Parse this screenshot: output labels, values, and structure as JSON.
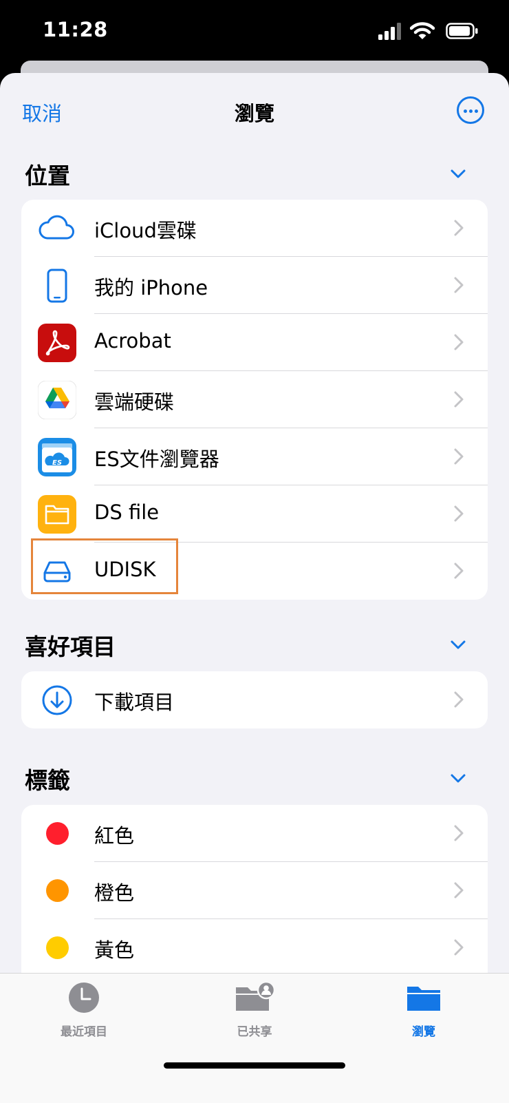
{
  "status_bar": {
    "time": "11:28"
  },
  "nav": {
    "cancel": "取消",
    "title": "瀏覽"
  },
  "sections": {
    "locations": {
      "title": "位置",
      "items": [
        {
          "label": "iCloud雲碟",
          "icon": "cloud-icon"
        },
        {
          "label": "我的 iPhone",
          "icon": "iphone-icon"
        },
        {
          "label": "Acrobat",
          "icon": "acrobat-icon"
        },
        {
          "label": "雲端硬碟",
          "icon": "google-drive-icon"
        },
        {
          "label": "ES文件瀏覽器",
          "icon": "es-file-explorer-icon"
        },
        {
          "label": "DS file",
          "icon": "folder-icon"
        },
        {
          "label": "UDISK",
          "icon": "drive-icon"
        }
      ]
    },
    "favorites": {
      "title": "喜好項目",
      "items": [
        {
          "label": "下載項目",
          "icon": "download-icon"
        }
      ]
    },
    "tags": {
      "title": "標籤",
      "items": [
        {
          "label": "紅色",
          "color": "#ff1f2d"
        },
        {
          "label": "橙色",
          "color": "#ff9500"
        },
        {
          "label": "黃色",
          "color": "#ffcc00"
        }
      ]
    }
  },
  "tab_bar": {
    "tabs": [
      {
        "label": "最近項目",
        "icon": "clock-icon",
        "active": false
      },
      {
        "label": "已共享",
        "icon": "shared-folder-icon",
        "active": false
      },
      {
        "label": "瀏覽",
        "icon": "folder-icon",
        "active": true
      }
    ]
  },
  "colors": {
    "accent": "#1477e6",
    "highlight": "#e5853b",
    "inactive": "#8e8e93"
  }
}
